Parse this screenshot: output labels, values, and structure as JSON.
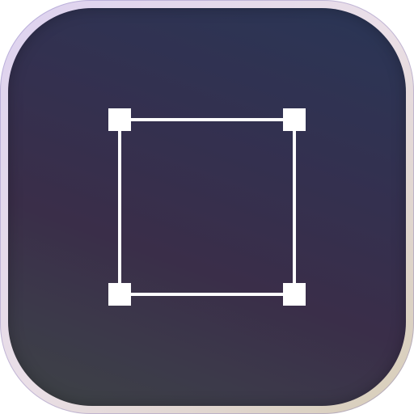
{
  "app_icon": {
    "icon": "selection-square-icon",
    "colors": {
      "rim_light": "#eadfe7",
      "rim_warm": "#d7cdb7",
      "face_top": "#2a3656",
      "face_mid": "#3a2e49",
      "face_bottom": "#3e4345",
      "glyph": "#ffffff"
    }
  }
}
